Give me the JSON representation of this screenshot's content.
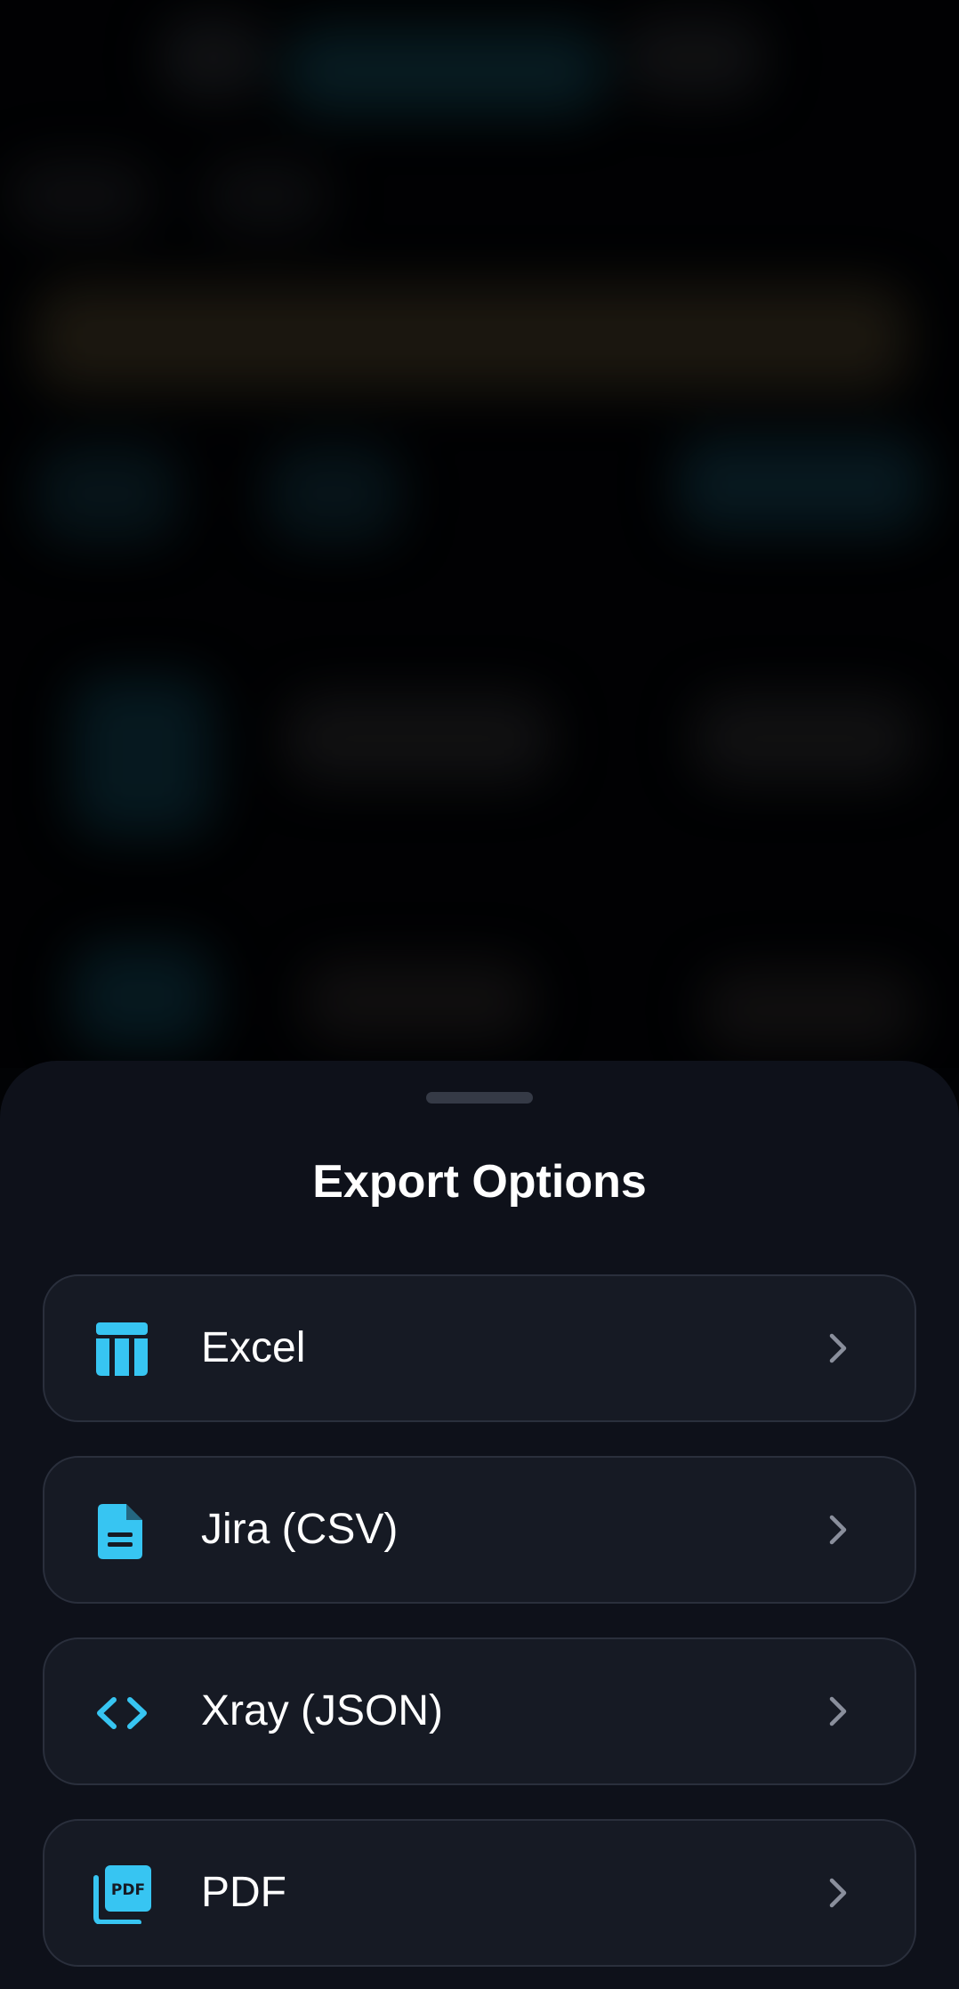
{
  "sheet": {
    "title": "Export Options",
    "options": [
      {
        "label": "Excel",
        "icon": "table-icon"
      },
      {
        "label": "Jira (CSV)",
        "icon": "document-icon"
      },
      {
        "label": "Xray (JSON)",
        "icon": "code-icon"
      },
      {
        "label": "PDF",
        "icon": "pdf-icon"
      }
    ]
  },
  "colors": {
    "accent": "#37c5f2",
    "sheet_background": "#0e111a",
    "card_background": "#161a24",
    "card_border": "#2a2f3c",
    "chevron": "#8a8f9c"
  }
}
